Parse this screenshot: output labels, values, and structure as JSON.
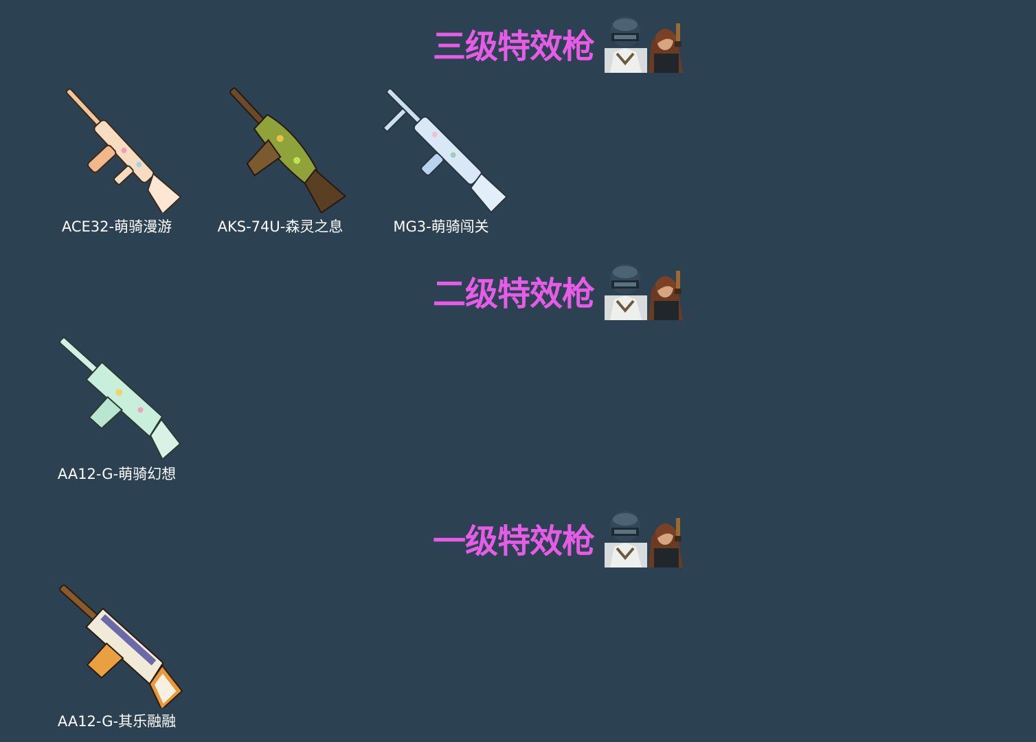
{
  "sections": [
    {
      "title": "三级特效枪",
      "items": [
        {
          "name": "ACE32-萌骑漫游",
          "icon": "rifle-pastel-icon"
        },
        {
          "name": "AKS-74U-森灵之息",
          "icon": "smg-forest-icon"
        },
        {
          "name": "MG3-萌骑闯关",
          "icon": "lmg-pastel-icon"
        }
      ]
    },
    {
      "title": "二级特效枪",
      "items": [
        {
          "name": "AA12-G-萌骑幻想",
          "icon": "shotgun-mint-icon"
        }
      ]
    },
    {
      "title": "一级特效枪",
      "items": [
        {
          "name": "AA12-G-其乐融融",
          "icon": "shotgun-orange-icon"
        }
      ]
    }
  ],
  "colors": {
    "background": "#2c4152",
    "title": "#e65ce6",
    "label": "#ffffff"
  }
}
